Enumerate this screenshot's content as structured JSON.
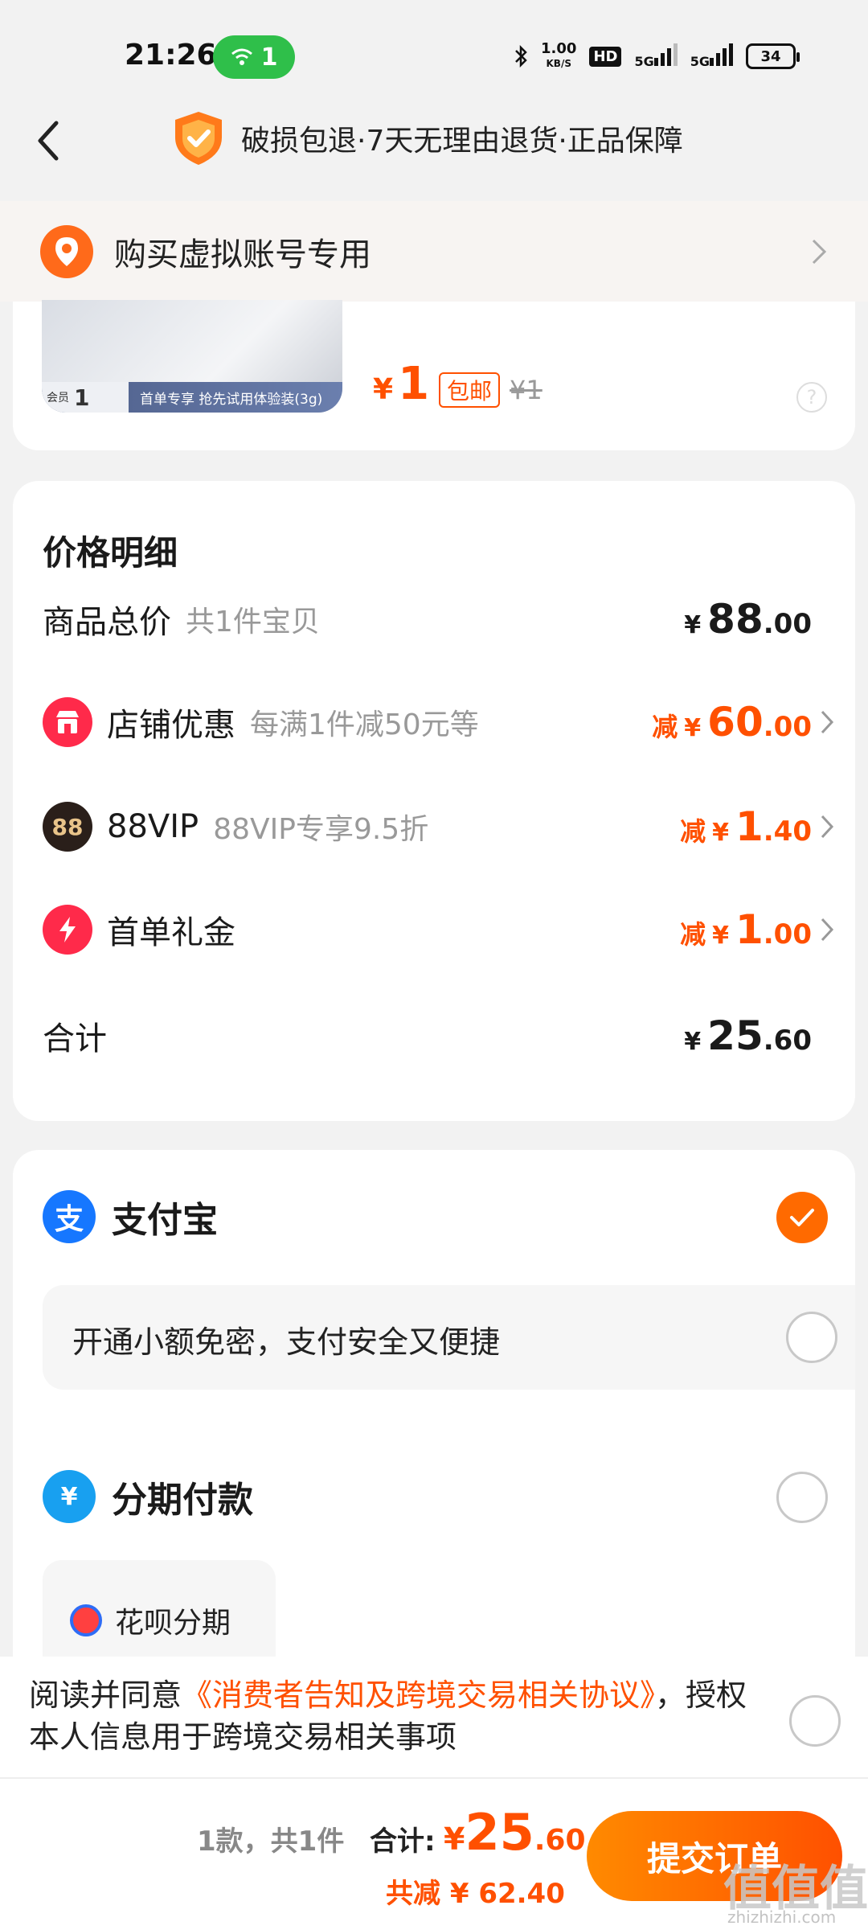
{
  "status_bar": {
    "time": "21:26",
    "wifi_count": "1",
    "net_speed": "1.00",
    "net_unit": "KB/S",
    "hd": "HD",
    "sig1": "5G",
    "sig2": "5G",
    "battery": "34"
  },
  "header": {
    "guarantee": "破损包退·7天无理由退货·正品保障"
  },
  "address": {
    "text": "购买虚拟账号专用"
  },
  "product": {
    "thumb_member": "会员",
    "thumb_member_price": "1",
    "thumb_promo": "首单专享 抢先试用体验装(3g)",
    "currency": "¥",
    "price": "1",
    "free_shipping": "包邮",
    "original_price": "¥1"
  },
  "price_details": {
    "title": "价格明细",
    "goods_total": {
      "label": "商品总价",
      "sub": "共1件宝贝",
      "currency": "¥",
      "int": "88",
      "dec": ".00"
    },
    "shop_discount": {
      "label": "店铺优惠",
      "sub": "每满1件减50元等",
      "prefix": "减",
      "currency": "¥",
      "int": "60",
      "dec": ".00"
    },
    "vip": {
      "icon": "88",
      "label": "88VIP",
      "sub": "88VIP专享9.5折",
      "prefix": "减",
      "currency": "¥",
      "int": "1",
      "dec": ".40"
    },
    "first_gift": {
      "label": "首单礼金",
      "prefix": "减",
      "currency": "¥",
      "int": "1",
      "dec": ".00"
    },
    "total": {
      "label": "合计",
      "currency": "¥",
      "int": "25",
      "dec": ".60"
    }
  },
  "payment": {
    "alipay_icon": "支",
    "alipay_label": "支付宝",
    "no_password": "开通小额免密，支付安全又便捷",
    "installment_icon": "¥",
    "installment_label": "分期付款",
    "huabei_label": "花呗分期"
  },
  "agreement": {
    "prefix": "阅读并同意",
    "link": "《消费者告知及跨境交易相关协议》",
    "suffix": "，授权本人信息用于跨境交易相关事项"
  },
  "bottom": {
    "count": "1款，共1件",
    "total_label": "合计:",
    "currency": "¥",
    "total_int": "25",
    "total_dec": ".60",
    "saved": "共减 ¥ 62.40",
    "submit": "提交订单"
  },
  "watermark": {
    "text": "值值值",
    "sub": "zhizhizhi.com"
  },
  "colors": {
    "accent": "#ff5000",
    "alipay": "#1677ff",
    "wifi": "#2fbf4a"
  }
}
